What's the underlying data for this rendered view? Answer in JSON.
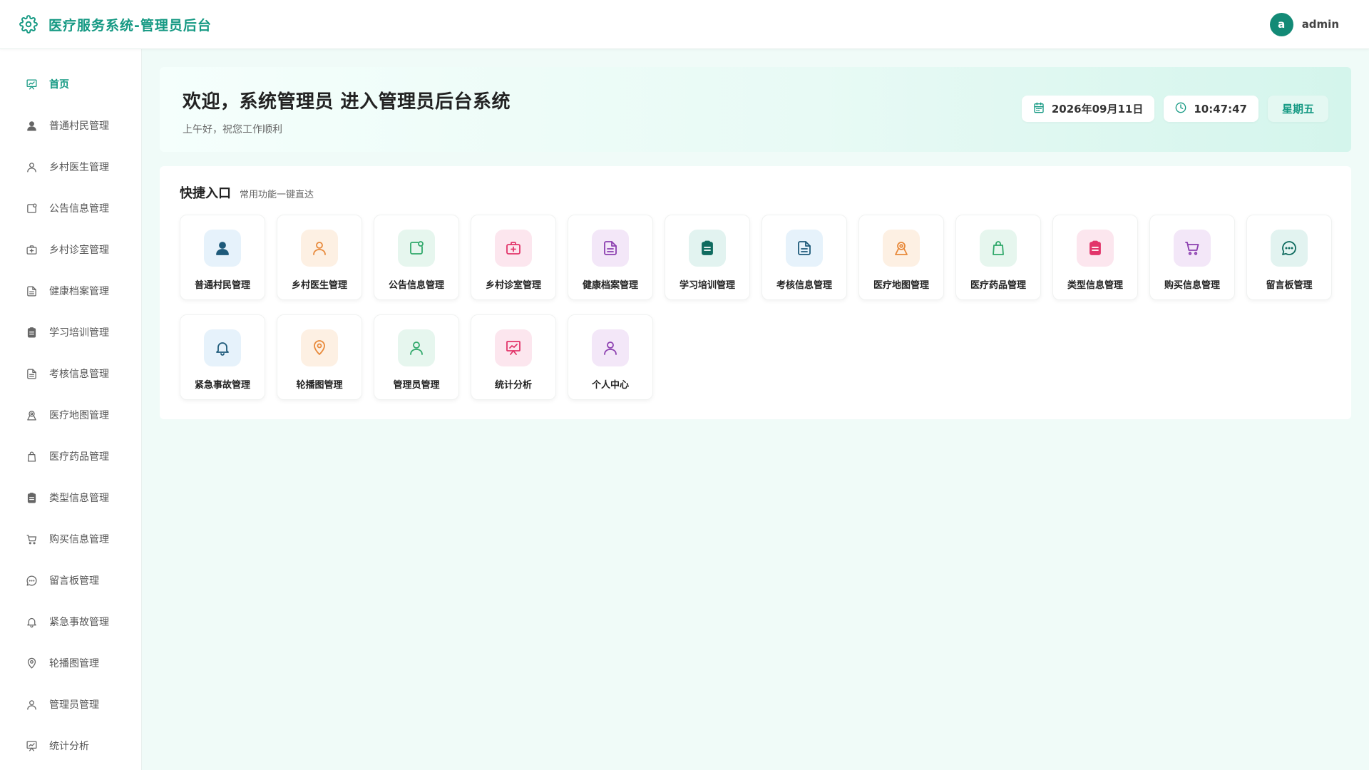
{
  "header": {
    "title": "医疗服务系统-管理员后台",
    "brand_icon": "gear-icon",
    "avatar_letter": "a",
    "username": "admin"
  },
  "sidebar": {
    "items": [
      {
        "label": "首页",
        "icon": "chart-board-icon",
        "active": true
      },
      {
        "label": "普通村民管理",
        "icon": "user-filled-icon"
      },
      {
        "label": "乡村医生管理",
        "icon": "user-outline-icon"
      },
      {
        "label": "公告信息管理",
        "icon": "notice-icon"
      },
      {
        "label": "乡村诊室管理",
        "icon": "medical-box-icon"
      },
      {
        "label": "健康档案管理",
        "icon": "document-icon"
      },
      {
        "label": "学习培训管理",
        "icon": "clipboard-icon"
      },
      {
        "label": "考核信息管理",
        "icon": "document-icon"
      },
      {
        "label": "医疗地图管理",
        "icon": "map-pin-icon"
      },
      {
        "label": "医疗药品管理",
        "icon": "bag-icon"
      },
      {
        "label": "类型信息管理",
        "icon": "clipboard-icon"
      },
      {
        "label": "购买信息管理",
        "icon": "cart-icon"
      },
      {
        "label": "留言板管理",
        "icon": "chat-icon"
      },
      {
        "label": "紧急事故管理",
        "icon": "bell-icon"
      },
      {
        "label": "轮播图管理",
        "icon": "location-icon"
      },
      {
        "label": "管理员管理",
        "icon": "user-outline-icon"
      },
      {
        "label": "统计分析",
        "icon": "chart-board-icon"
      }
    ]
  },
  "banner": {
    "title": "欢迎，系统管理员 进入管理员后台系统",
    "subtitle": "上午好，祝您工作顺利",
    "date": "2026年09月11日",
    "time": "10:47:47",
    "weekday": "星期五"
  },
  "quick": {
    "title": "快捷入口",
    "subtitle": "常用功能一键直达",
    "tiles": [
      {
        "label": "普通村民管理",
        "icon": "user-filled-icon",
        "color": "#1e5a7a",
        "bg": "#e6f2fb"
      },
      {
        "label": "乡村医生管理",
        "icon": "user-outline-icon",
        "color": "#e8893a",
        "bg": "#fdf0e3"
      },
      {
        "label": "公告信息管理",
        "icon": "notice-icon",
        "color": "#2fa86a",
        "bg": "#e6f6ee"
      },
      {
        "label": "乡村诊室管理",
        "icon": "medical-box-icon",
        "color": "#e2356a",
        "bg": "#fce6ee"
      },
      {
        "label": "健康档案管理",
        "icon": "document-icon",
        "color": "#8c3fb0",
        "bg": "#f3e7f8"
      },
      {
        "label": "学习培训管理",
        "icon": "clipboard-icon",
        "color": "#0f6b5f",
        "bg": "#e2f3f0"
      },
      {
        "label": "考核信息管理",
        "icon": "document-icon",
        "color": "#1e5a7a",
        "bg": "#e6f2fb"
      },
      {
        "label": "医疗地图管理",
        "icon": "map-pin-icon",
        "color": "#e8893a",
        "bg": "#fdf0e3"
      },
      {
        "label": "医疗药品管理",
        "icon": "bag-icon",
        "color": "#2fa86a",
        "bg": "#e6f6ee"
      },
      {
        "label": "类型信息管理",
        "icon": "clipboard-icon",
        "color": "#e2356a",
        "bg": "#fce6ee"
      },
      {
        "label": "购买信息管理",
        "icon": "cart-icon",
        "color": "#8c3fb0",
        "bg": "#f3e7f8"
      },
      {
        "label": "留言板管理",
        "icon": "chat-icon",
        "color": "#0f6b5f",
        "bg": "#e2f3f0"
      },
      {
        "label": "紧急事故管理",
        "icon": "bell-icon",
        "color": "#1e5a7a",
        "bg": "#e6f2fb"
      },
      {
        "label": "轮播图管理",
        "icon": "location-icon",
        "color": "#e8893a",
        "bg": "#fdf0e3"
      },
      {
        "label": "管理员管理",
        "icon": "user-outline-icon",
        "color": "#2fa86a",
        "bg": "#e6f6ee"
      },
      {
        "label": "统计分析",
        "icon": "chart-board-icon",
        "color": "#e2356a",
        "bg": "#fce6ee"
      },
      {
        "label": "个人中心",
        "icon": "user-outline-icon",
        "color": "#8c3fb0",
        "bg": "#f3e7f8"
      }
    ]
  },
  "colors": {
    "accent": "#159983",
    "background": "#f0fbf8"
  }
}
